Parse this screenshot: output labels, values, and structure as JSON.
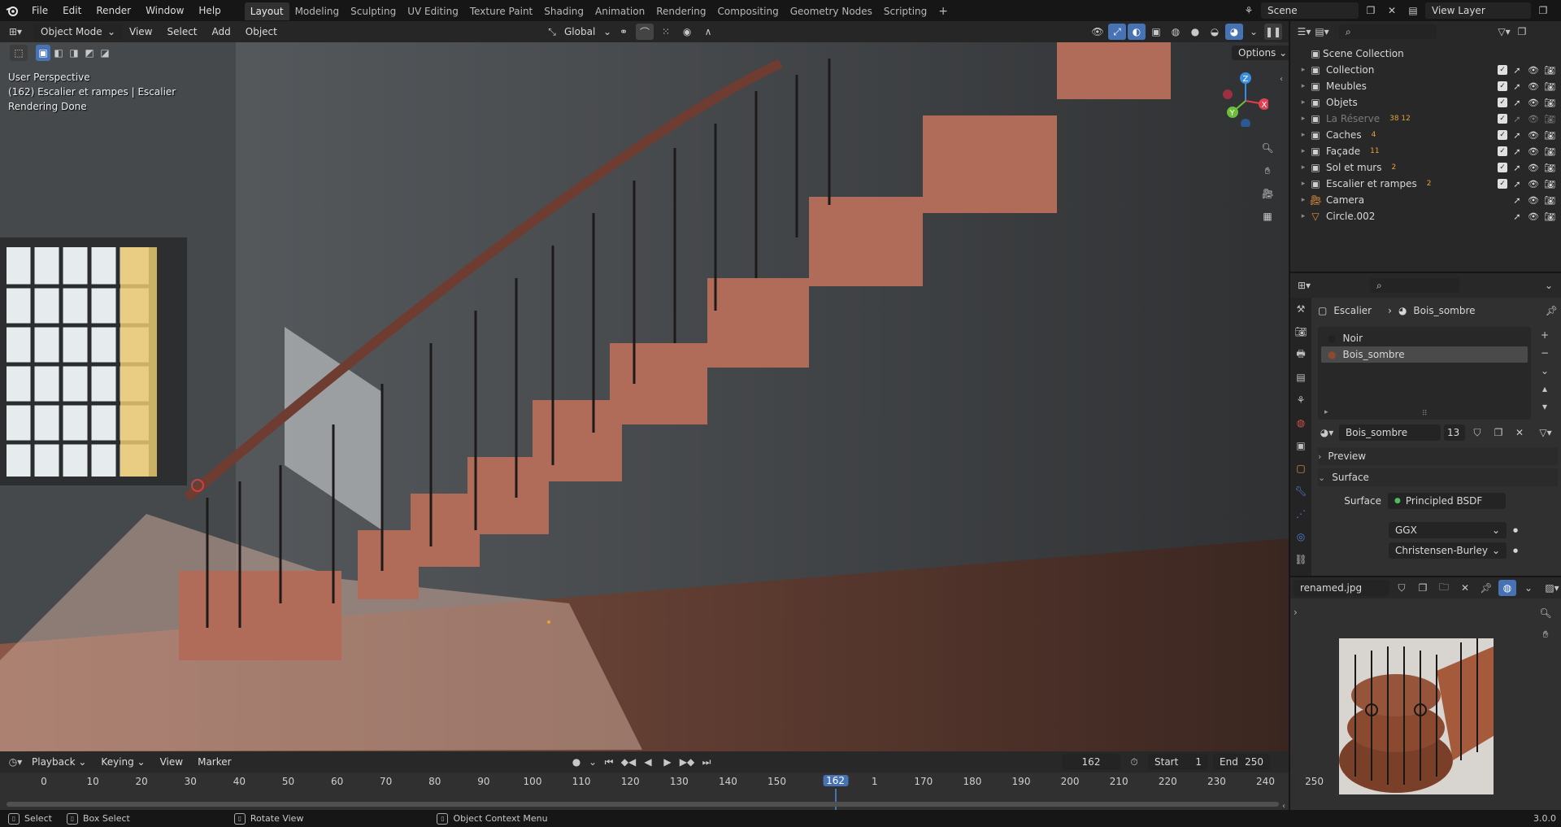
{
  "app_menu": [
    "File",
    "Edit",
    "Render",
    "Window",
    "Help"
  ],
  "workspace_tabs": [
    "Layout",
    "Modeling",
    "Sculpting",
    "UV Editing",
    "Texture Paint",
    "Shading",
    "Animation",
    "Rendering",
    "Compositing",
    "Geometry Nodes",
    "Scripting"
  ],
  "active_workspace": "Layout",
  "add_workspace": "+",
  "scene_name": "Scene",
  "view_layer": "View Layer",
  "viewport_header": {
    "mode": "Object Mode",
    "menus": [
      "View",
      "Select",
      "Add",
      "Object"
    ],
    "transform_orientation": "Global",
    "options": "Options"
  },
  "viewport_overlay": {
    "line1": "User Perspective",
    "line2": "(162) Escalier et rampes | Escalier",
    "line3": "Rendering Done"
  },
  "gizmo_axes": {
    "z": "Z",
    "y": "Y",
    "x": "X"
  },
  "outliner": {
    "root": "Scene Collection",
    "items": [
      {
        "label": "Collection",
        "dim": false,
        "badge": "",
        "checked": true
      },
      {
        "label": "Meubles",
        "dim": false,
        "badge": "",
        "checked": true
      },
      {
        "label": "Objets",
        "dim": false,
        "badge": "",
        "checked": true
      },
      {
        "label": "La Réserve",
        "dim": true,
        "badge": "38 12",
        "checked": true
      },
      {
        "label": "Caches",
        "dim": false,
        "badge": "4",
        "checked": true
      },
      {
        "label": "Façade",
        "dim": false,
        "badge": "11",
        "checked": true
      },
      {
        "label": "Sol et murs",
        "dim": false,
        "badge": "2",
        "checked": true
      },
      {
        "label": "Escalier et rampes",
        "dim": false,
        "badge": "2",
        "checked": true
      },
      {
        "label": "Camera",
        "dim": false,
        "badge": "",
        "checked": false
      },
      {
        "label": "Circle.002",
        "dim": false,
        "badge": "",
        "checked": false
      }
    ]
  },
  "properties": {
    "breadcrumb_object": "Escalier",
    "breadcrumb_material": "Bois_sombre",
    "material_slots": [
      "Noir",
      "Bois_sombre"
    ],
    "selected_slot": "Bois_sombre",
    "material_name": "Bois_sombre",
    "user_count": "13",
    "preview_label": "Preview",
    "surface_panel": "Surface",
    "surface_label": "Surface",
    "surface_value": "Principled BSDF",
    "distribution": "GGX",
    "subsurface": "Christensen-Burley"
  },
  "image_editor": {
    "image_name": "renamed.jpg"
  },
  "timeline": {
    "menus": [
      "Playback",
      "Keying",
      "View",
      "Marker"
    ],
    "current_frame": "162",
    "start_label": "Start",
    "start_value": "1",
    "end_label": "End",
    "end_value": "250",
    "ticks": [
      "0",
      "10",
      "20",
      "30",
      "40",
      "50",
      "60",
      "70",
      "80",
      "90",
      "100",
      "110",
      "120",
      "130",
      "140",
      "150",
      "1",
      "170",
      "180",
      "190",
      "200",
      "210",
      "220",
      "230",
      "240",
      "250"
    ],
    "playhead_label": "162"
  },
  "statusbar": {
    "select": "Select",
    "box_select": "Box Select",
    "rotate_view": "Rotate View",
    "context_menu": "Object Context Menu",
    "version": "3.0.0"
  }
}
